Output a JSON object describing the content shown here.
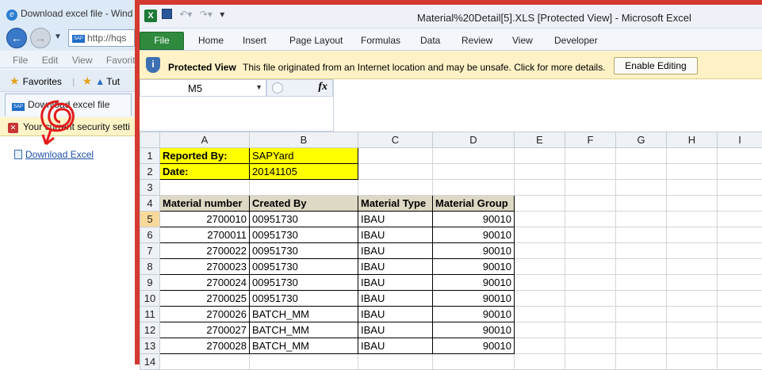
{
  "ie": {
    "title": "Download excel file - Wind",
    "address": "http://hqs",
    "menu": [
      "File",
      "Edit",
      "View",
      "Favorite"
    ],
    "favorites_label": "Favorites",
    "favorites_extra": "Tut",
    "tab_label": "Download excel file",
    "info_text": "Your current security setti",
    "link_text": "Download Excel"
  },
  "excel": {
    "window_title": "Material%20Detail[5].XLS  [Protected View]  -  Microsoft Excel",
    "ribbon_tabs": [
      "File",
      "Home",
      "Insert",
      "Page Layout",
      "Formulas",
      "Data",
      "Review",
      "View",
      "Developer"
    ],
    "protected_view": {
      "title": "Protected View",
      "message": "This file originated from an Internet location and may be unsafe. Click for more details.",
      "button": "Enable Editing"
    },
    "name_box": "M5",
    "fx_label": "fx",
    "columns": [
      "A",
      "B",
      "C",
      "D",
      "E",
      "F",
      "G",
      "H",
      "I"
    ],
    "selected_row": "5",
    "rows": [
      {
        "num": "1",
        "a": "Reported By:",
        "b": "SAPYard",
        "c": "",
        "d": ""
      },
      {
        "num": "2",
        "a": "Date:",
        "b": "20141105",
        "c": "",
        "d": ""
      },
      {
        "num": "3",
        "a": "",
        "b": "",
        "c": "",
        "d": ""
      },
      {
        "num": "4",
        "a": "Material number",
        "b": "Created By",
        "c": "Material Type",
        "d": "Material Group"
      },
      {
        "num": "5",
        "a": "2700010",
        "b": "00951730",
        "c": "IBAU",
        "d": "90010"
      },
      {
        "num": "6",
        "a": "2700011",
        "b": "00951730",
        "c": "IBAU",
        "d": "90010"
      },
      {
        "num": "7",
        "a": "2700022",
        "b": "00951730",
        "c": "IBAU",
        "d": "90010"
      },
      {
        "num": "8",
        "a": "2700023",
        "b": "00951730",
        "c": "IBAU",
        "d": "90010"
      },
      {
        "num": "9",
        "a": "2700024",
        "b": "00951730",
        "c": "IBAU",
        "d": "90010"
      },
      {
        "num": "10",
        "a": "2700025",
        "b": "00951730",
        "c": "IBAU",
        "d": "90010"
      },
      {
        "num": "11",
        "a": "2700026",
        "b": "BATCH_MM",
        "c": "IBAU",
        "d": "90010"
      },
      {
        "num": "12",
        "a": "2700027",
        "b": "BATCH_MM",
        "c": "IBAU",
        "d": "90010"
      },
      {
        "num": "13",
        "a": "2700028",
        "b": "BATCH_MM",
        "c": "IBAU",
        "d": "90010"
      },
      {
        "num": "14",
        "a": "",
        "b": "",
        "c": "",
        "d": ""
      }
    ]
  }
}
